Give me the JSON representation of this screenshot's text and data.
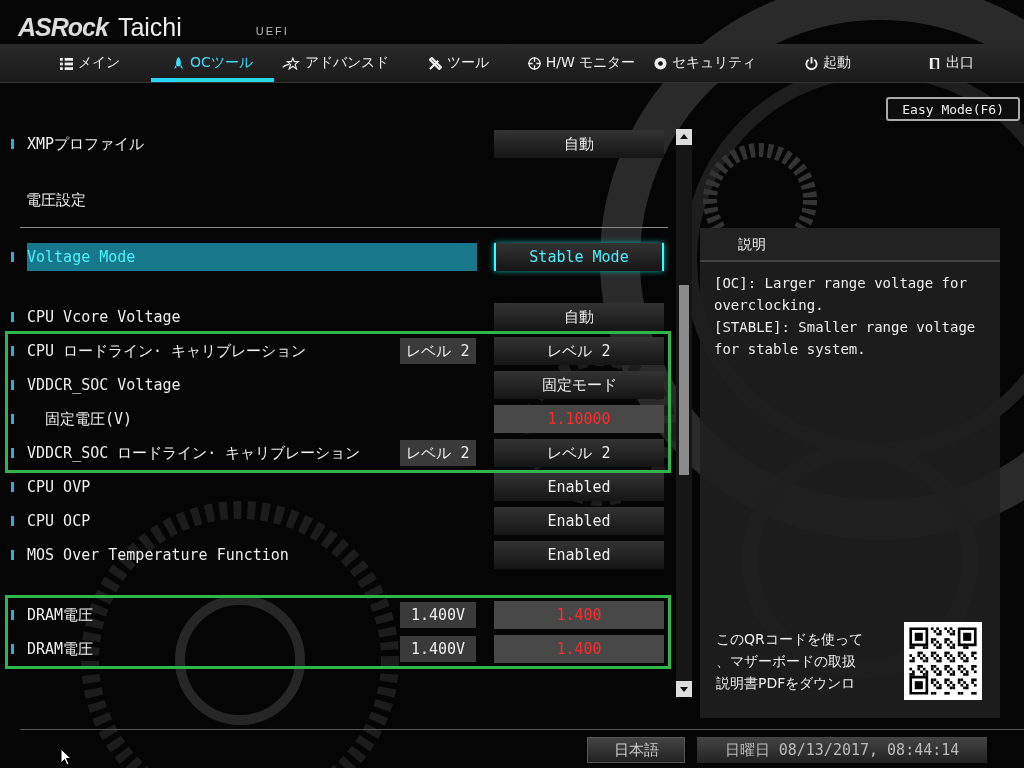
{
  "header": {
    "brand": "ASRock",
    "model": "Taichi",
    "firmware": "UEFI"
  },
  "tabs": [
    {
      "label": "メイン",
      "selected": false
    },
    {
      "label": "OCツール",
      "selected": true
    },
    {
      "label": "アドバンスド",
      "selected": false
    },
    {
      "label": "ツール",
      "selected": false
    },
    {
      "label": "H/W モニター",
      "selected": false
    },
    {
      "label": "セキュリティ",
      "selected": false
    },
    {
      "label": "起動",
      "selected": false
    },
    {
      "label": "出口",
      "selected": false
    }
  ],
  "easy_mode_button": "Easy Mode(F6)",
  "sections": [
    {
      "outlined": false,
      "rows": [
        {
          "kind": "setting",
          "label": "XMPプロファイル",
          "value": {
            "text": "自動",
            "kind": "button"
          },
          "selected": false
        }
      ]
    },
    {
      "outlined": false,
      "title": "電圧設定",
      "rows": [
        {
          "kind": "setting",
          "label": "Voltage Mode",
          "value": {
            "text": "Stable Mode",
            "kind": "button"
          },
          "selected": true
        }
      ]
    },
    {
      "outlined": false,
      "rows": [
        {
          "kind": "setting",
          "label": "CPU Vcore Voltage",
          "value": {
            "text": "自動",
            "kind": "button"
          },
          "selected": false
        }
      ]
    },
    {
      "outlined": true,
      "rows": [
        {
          "kind": "setting",
          "label": "CPU ロードライン· キャリブレーション",
          "current": "レベル 2",
          "value": {
            "text": "レベル 2",
            "kind": "button"
          },
          "selected": false
        },
        {
          "kind": "setting",
          "label": "VDDCR_SOC Voltage",
          "value": {
            "text": "固定モード",
            "kind": "button"
          },
          "selected": false
        },
        {
          "kind": "subsetting",
          "label": "固定電圧(V)",
          "value": {
            "text": "1.10000",
            "kind": "field"
          },
          "selected": false
        },
        {
          "kind": "setting",
          "label": "VDDCR_SOC ロードライン· キャリブレーション",
          "current": "レベル 2",
          "value": {
            "text": "レベル 2",
            "kind": "button"
          },
          "selected": false
        }
      ]
    },
    {
      "outlined": false,
      "rows": [
        {
          "kind": "setting",
          "label": "CPU OVP",
          "value": {
            "text": "Enabled",
            "kind": "button"
          },
          "selected": false
        },
        {
          "kind": "setting",
          "label": "CPU OCP",
          "value": {
            "text": "Enabled",
            "kind": "button"
          },
          "selected": false
        },
        {
          "kind": "setting",
          "label": "MOS Over Temperature Function",
          "value": {
            "text": "Enabled",
            "kind": "button"
          },
          "selected": false
        }
      ]
    },
    {
      "outlined": true,
      "rows": [
        {
          "kind": "setting",
          "label": "DRAM電圧",
          "current": "1.400V",
          "value": {
            "text": "1.400",
            "kind": "field"
          },
          "selected": false
        },
        {
          "kind": "setting",
          "label": "DRAM電圧",
          "current": "1.400V",
          "value": {
            "text": "1.400",
            "kind": "field"
          },
          "selected": false
        }
      ]
    }
  ],
  "description": {
    "title": "説明",
    "paragraphs": [
      "[OC]: Larger range voltage for overclocking.",
      "[STABLE]: Smaller range voltage for stable system."
    ],
    "qr_text": [
      "このQRコードを使って",
      "、マザーボードの取扱",
      "説明書PDFをダウンロ"
    ]
  },
  "status_bar": {
    "language": "日本語",
    "datetime": "日曜日 08/13/2017, 08:44:14"
  }
}
